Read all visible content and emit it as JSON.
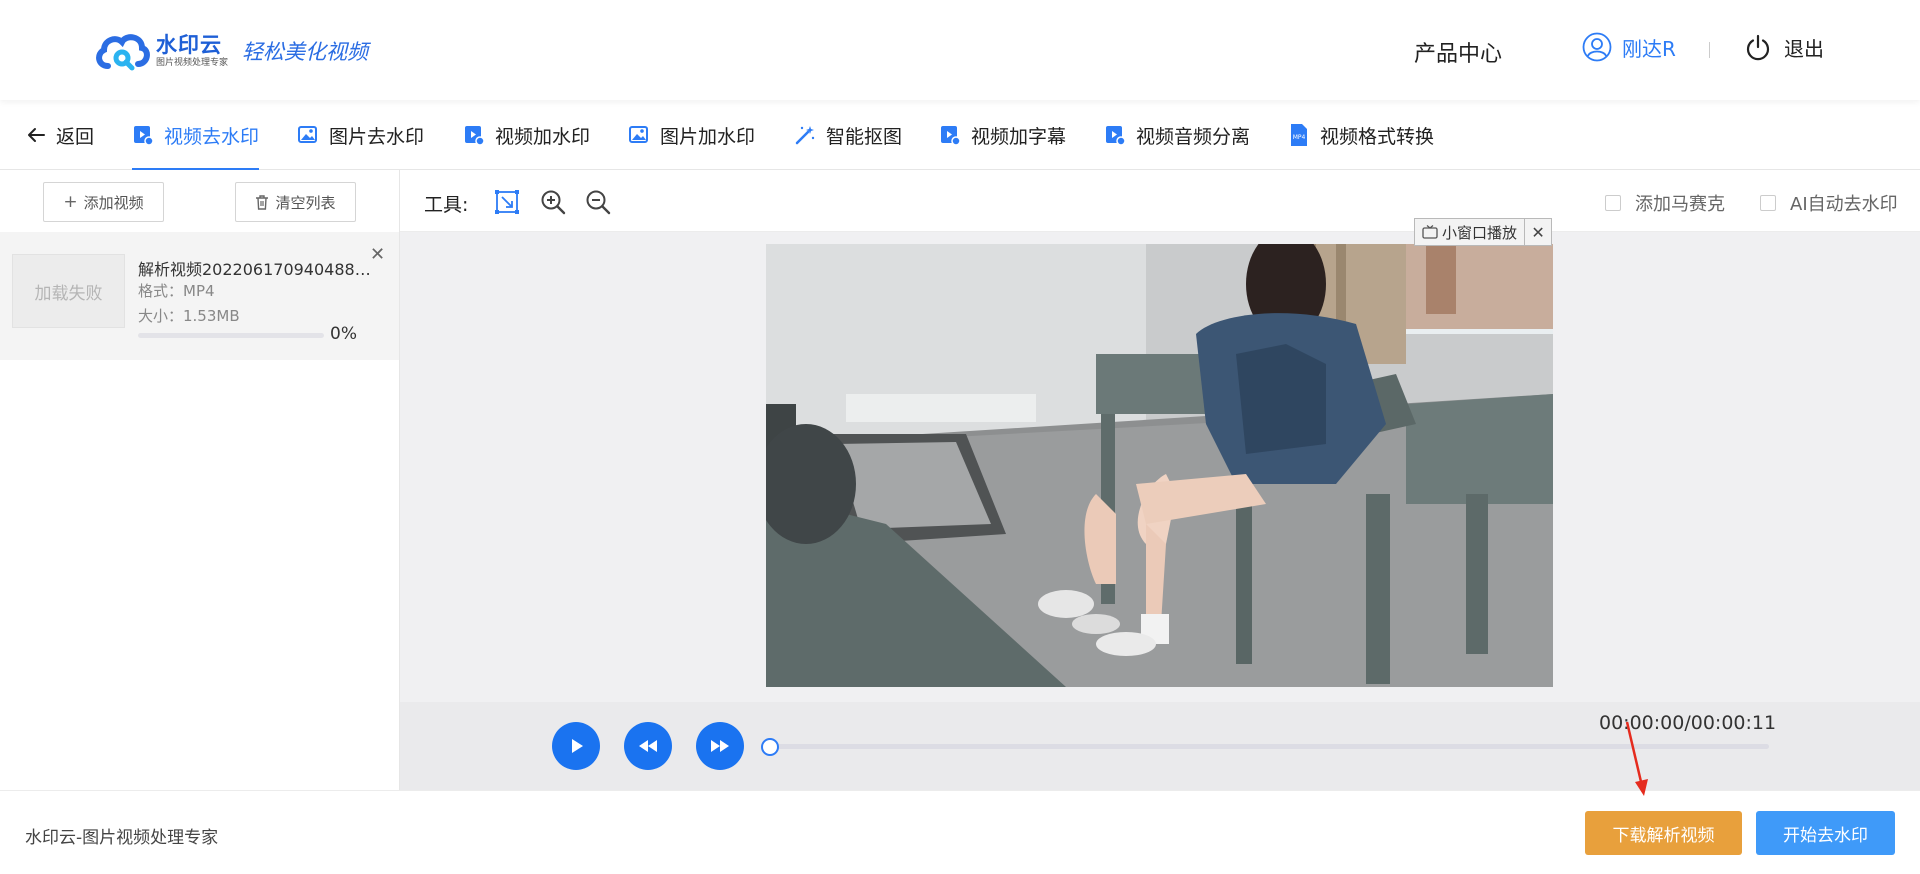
{
  "header": {
    "logo_name": "水印云",
    "logo_subtitle": "图片视频处理专家",
    "slogan": "轻松美化视频",
    "product_center": "产品中心",
    "username": "刚达R",
    "logout": "退出",
    "icons": [
      "cloud-logo",
      "user-icon",
      "power-icon"
    ]
  },
  "tabs": {
    "back": "返回",
    "items": [
      {
        "label": "视频去水印",
        "icon": "video-icon",
        "active": true
      },
      {
        "label": "图片去水印",
        "icon": "image-icon"
      },
      {
        "label": "视频加水印",
        "icon": "video-icon"
      },
      {
        "label": "图片加水印",
        "icon": "image-icon"
      },
      {
        "label": "智能抠图",
        "icon": "magic-wand-icon"
      },
      {
        "label": "视频加字幕",
        "icon": "video-icon"
      },
      {
        "label": "视频音频分离",
        "icon": "video-icon"
      },
      {
        "label": "视频格式转换",
        "icon": "mp4-file-icon"
      }
    ]
  },
  "sidebar": {
    "add_video": "添加视频",
    "clear_list": "清空列表",
    "file": {
      "thumb_text": "加载失败",
      "name": "解析视频20220617094048863...",
      "format": "格式：MP4",
      "size": "大小：1.53MB",
      "progress": 0,
      "progress_text": "0%"
    }
  },
  "toolbar": {
    "tools_label": "工具:",
    "tool_icons": [
      "select-area-icon",
      "zoom-in-icon",
      "zoom-out-icon"
    ],
    "mosaic": "添加马赛克",
    "ai_remove": "AI自动去水印"
  },
  "preview": {
    "pip_label": "小窗口播放"
  },
  "player": {
    "time": "00:00:00/00:00:11",
    "position": 0,
    "icons": [
      "play-icon",
      "rewind-icon",
      "fast-forward-icon"
    ]
  },
  "footer": {
    "text": "水印云-图片视频处理专家",
    "download_button": "下载解析视频",
    "start_button": "开始去水印"
  },
  "colors": {
    "accent": "#2d7cf6",
    "download": "#e8a03c",
    "start": "#3f9af9",
    "annotation_arrow": "#e52b1e"
  }
}
